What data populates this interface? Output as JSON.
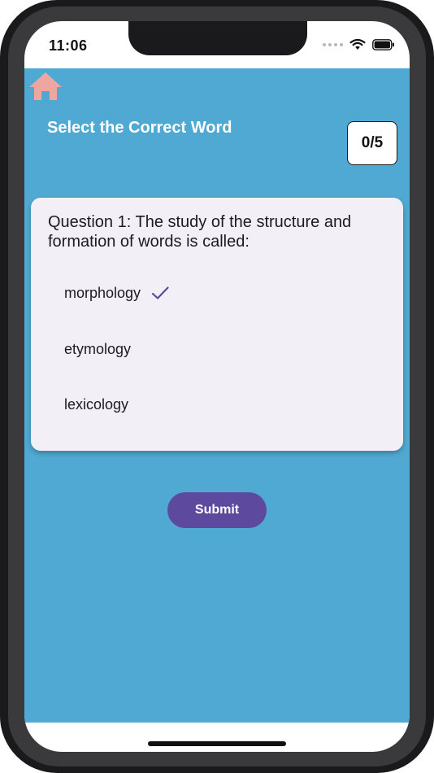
{
  "status_bar": {
    "time": "11:06"
  },
  "header": {
    "home_icon": "home-icon",
    "home_icon_color": "#f0a6a0",
    "title": "Select the Correct Word",
    "score": "0/5"
  },
  "quiz": {
    "question": "Question 1: The study of the structure and formation of words is called:",
    "options": [
      {
        "label": "morphology",
        "selected": true
      },
      {
        "label": "etymology",
        "selected": false
      },
      {
        "label": "lexicology",
        "selected": false
      }
    ],
    "check_icon": "checkmark-icon"
  },
  "actions": {
    "submit_label": "Submit"
  },
  "colors": {
    "background": "#4fa9d2",
    "card": "#f2eff6",
    "accent": "#5d4a9e",
    "home_icon": "#f0a6a0"
  }
}
